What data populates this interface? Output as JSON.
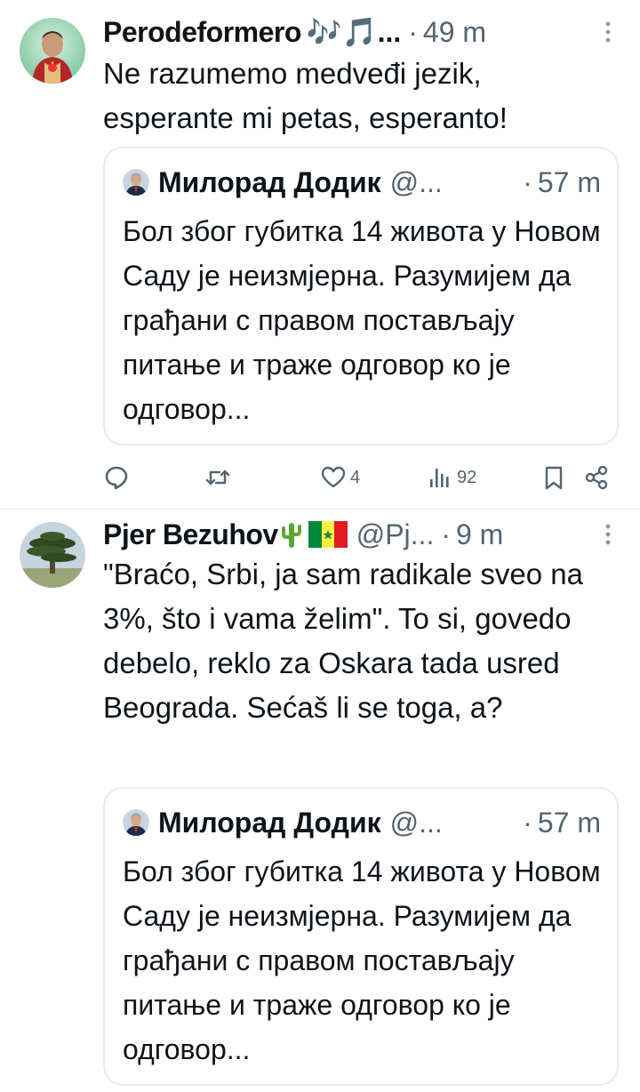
{
  "tweets": [
    {
      "author": {
        "display_name": "Perodeformero",
        "display_name_extra": "🎶🎵...",
        "avatar_icon": "sacred-heart-avatar"
      },
      "separator": "·",
      "time": "49 m",
      "text": "Ne razumemo medveđi jezik, esperante mi petas, esperanto!",
      "quote": {
        "display_name": "Милорад Додик",
        "handle": "@...",
        "separator": "·",
        "time": "57 m",
        "text": "Бол због губитка 14 живота у Новом Саду је неизмјерна. Разумијем да грађани с правом постављају питање и траже одговор ко је одговор..."
      },
      "actions": {
        "replies": "",
        "retweets": "",
        "likes": "4",
        "views": "92"
      }
    },
    {
      "author": {
        "display_name": "Pjer Bezuhov",
        "handle": "@Pj...",
        "avatar_icon": "tree-avatar"
      },
      "separator": "·",
      "time": "9 m",
      "text": "\"Braćo, Srbi, ja sam radikale sveo na 3%, što i vama želim\". To si, govedo debelo, reklo za Oskara tada usred Beograda. Sećaš li se toga, a?",
      "quote": {
        "display_name": "Милорад Додик",
        "handle": "@...",
        "separator": "·",
        "time": "57 m",
        "text": "Бол због губитка 14 живота у Новом Саду је неизмјерна. Разумијем да грађани с правом постављају питање и траже одговор ко је одговор..."
      }
    }
  ],
  "colors": {
    "text_primary": "#0f1419",
    "text_secondary": "#536471",
    "border": "#e6eaec",
    "divider": "#eff3f4"
  }
}
